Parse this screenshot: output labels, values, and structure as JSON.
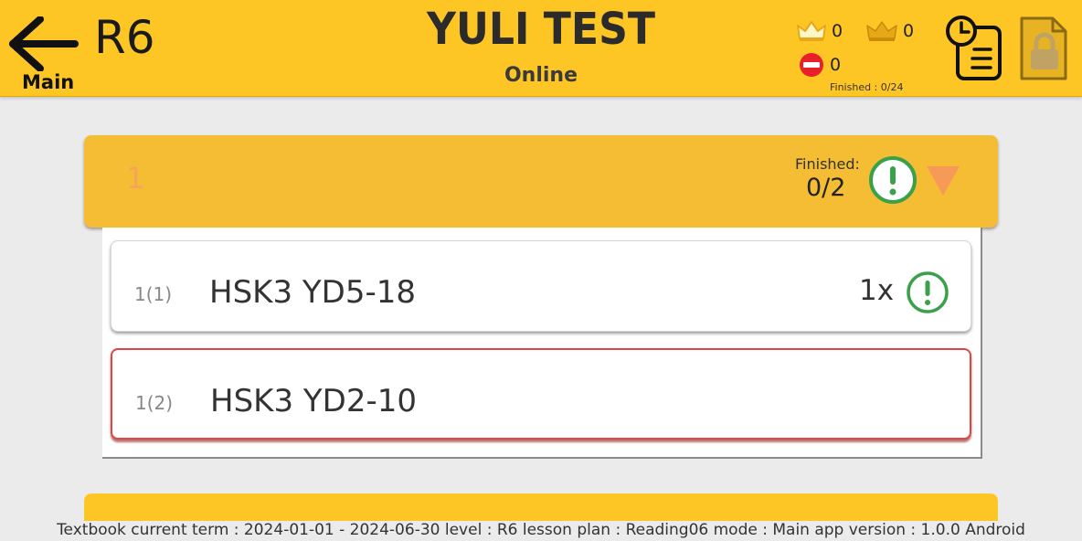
{
  "header": {
    "back_label": "Main",
    "level": "R6",
    "title": "YULI TEST",
    "status": "Online",
    "stats": {
      "crown_silver_count": "0",
      "crown_gold_count": "0",
      "blocked_count": "0",
      "finished": "Finished : 0/24"
    },
    "colors": {
      "bar": "#fec625",
      "crown": "#e6a817",
      "blocked": "#e8202a"
    }
  },
  "group": {
    "number": "1",
    "finished_label": "Finished:",
    "finished_value": "0/2",
    "colors": {
      "header": "#f4bd34",
      "status_ring": "#3aa04a",
      "arrow": "#f79a57"
    }
  },
  "lessons": [
    {
      "index": "1(1)",
      "name": "HSK3 YD5-18",
      "count": "1x",
      "status_icon": "alert-circle-icon"
    },
    {
      "index": "1(2)",
      "name": "HSK3 YD2-10",
      "count": "",
      "highlight_color": "#e04646"
    }
  ],
  "footer": {
    "text": "Textbook  current term : 2024-01-01 - 2024-06-30   level : R6   lesson plan : Reading06   mode : Main   app version : 1.0.0 Android"
  }
}
